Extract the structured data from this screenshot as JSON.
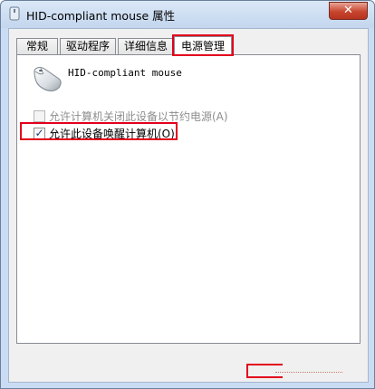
{
  "window": {
    "title": "HID-compliant mouse 属性",
    "close_label": "✕"
  },
  "tabs": [
    {
      "label": "常规",
      "active": false
    },
    {
      "label": "驱动程序",
      "active": false
    },
    {
      "label": "详细信息",
      "active": false
    },
    {
      "label": "电源管理",
      "active": true
    }
  ],
  "device": {
    "name": "HID-compliant mouse",
    "icon": "mouse-icon"
  },
  "options": [
    {
      "label": "允许计算机关闭此设备以节约电源(A)",
      "checked": false,
      "enabled": false
    },
    {
      "label": "允许此设备唤醒计算机(O)",
      "checked": true,
      "enabled": true
    }
  ],
  "colors": {
    "highlight": "#e3001b",
    "title_bar": "#c9dcf3",
    "close_button": "#c8452d"
  }
}
